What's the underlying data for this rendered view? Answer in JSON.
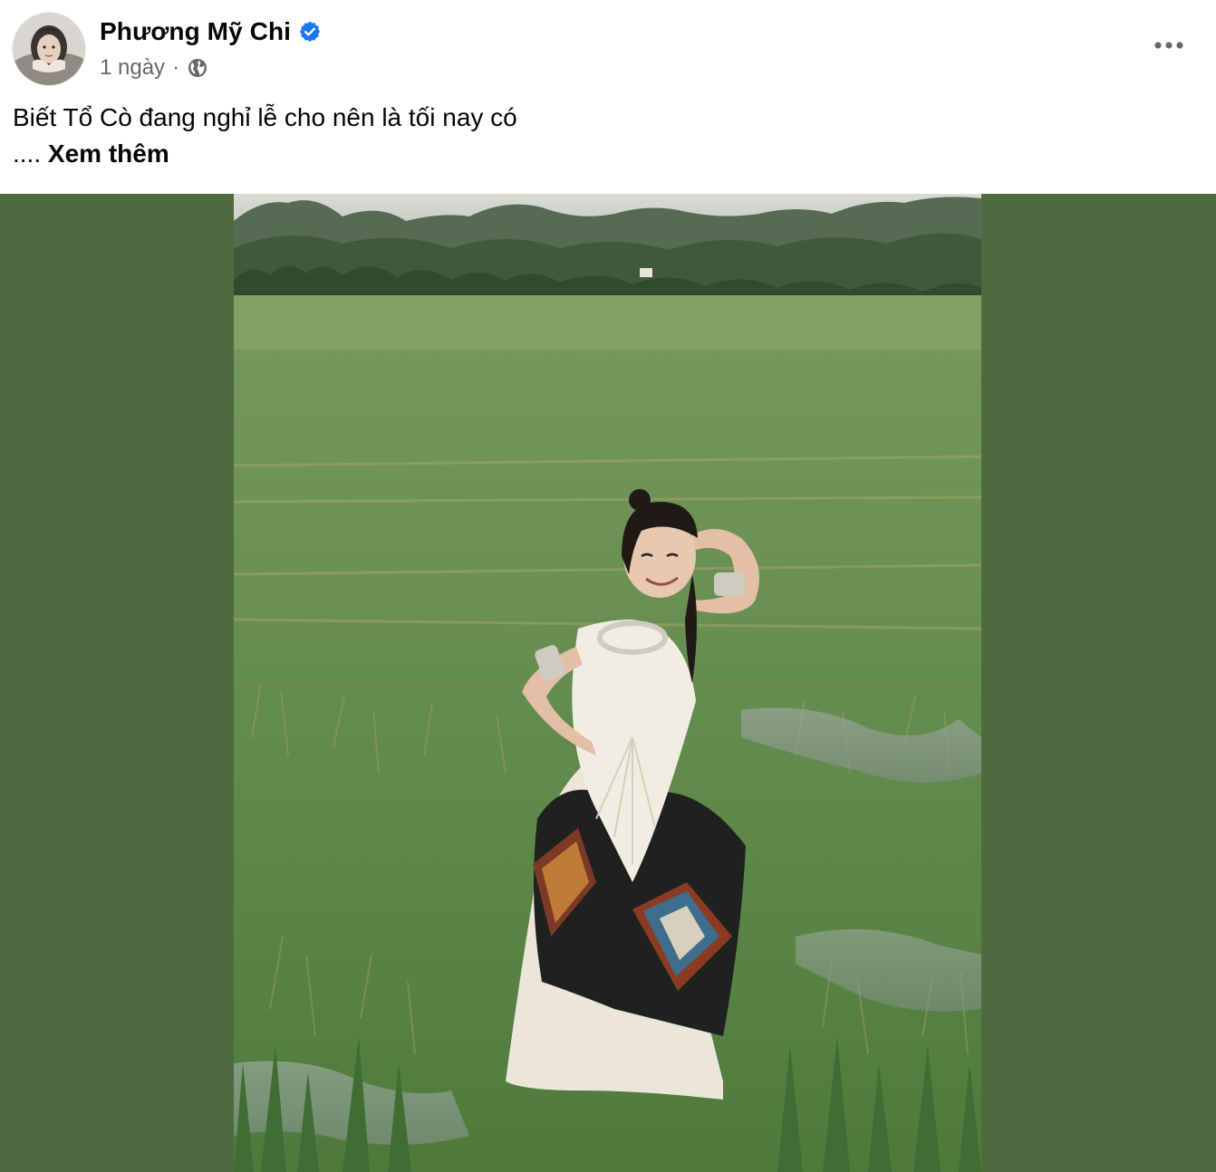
{
  "post": {
    "author": {
      "name": "Phương Mỹ Chi",
      "verified": true,
      "avatar_icon": "avatar-portrait"
    },
    "meta": {
      "time": "1 ngày",
      "separator": "·",
      "privacy_icon": "globe-icon"
    },
    "text": {
      "line1": "Biết Tổ Cò đang nghỉ lễ cho nên là tối nay có",
      "ellipsis": "....",
      "see_more": "Xem thêm"
    },
    "more_icon": "more-horizontal-icon",
    "colors": {
      "verified_blue": "#1877f2",
      "meta_gray": "#65676b",
      "media_background": "#4e6b3f"
    }
  }
}
